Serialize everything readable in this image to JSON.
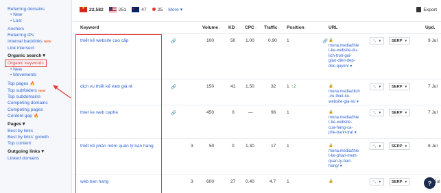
{
  "sidebar": {
    "referring_domains": "Referring domains",
    "rd_new": "• New",
    "rd_lost": "• Lost",
    "anchors": "Anchors",
    "referring_ips": "Referring IPs",
    "internal_backlinks": "Internal backlinks",
    "internal_backlinks_tag": "NEW",
    "link_intersect": "Link intersect",
    "organic_search": "Organic search ▾",
    "organic_keywords": "Organic keywords",
    "ok_new": "• New",
    "ok_movements": "• Movements",
    "top_pages": "Top pages",
    "top_subfolders": "Top subfolders",
    "top_subfolders_tag": "NEW",
    "top_subdomains": "Top subdomains",
    "competing_domains": "Competing domains",
    "competing_pages": "Competing pages",
    "content_gap": "Content gap",
    "pages": "Pages ▾",
    "best_by_links": "Best by links",
    "best_by_links_growth": "Best by links' growth",
    "top_content": "Top content",
    "outgoing_links": "Outgoing links ▾",
    "linked_domains": "Linked domains"
  },
  "filters": {
    "vn_count": "22,582",
    "us_count": "251",
    "au_count": "47",
    "other_count": "25",
    "more": "More ▾"
  },
  "export_label": "Export",
  "columns": {
    "keyword": "Keyword",
    "volume": "Volume",
    "kd": "KD",
    "cpc": "CPC",
    "traffic": "Traffic",
    "position": "Position",
    "url": "URL",
    "upd": "Upd."
  },
  "rows": [
    {
      "keyword": "thiết kế website cao cấp",
      "links": "",
      "volume": "100",
      "kd": "50",
      "cpc": "1.00",
      "traffic": "0.90",
      "position": "1",
      "change": "",
      "url_lines": [
        "mona.media/thie",
        "t-ke-website-du-",
        "lich-tron-goi-",
        "giao-dien-dep-",
        "doc-quyen/ ▾"
      ],
      "upd": "9 Jul"
    },
    {
      "keyword": "dịch vụ thiết kế web giá rẻ",
      "links": "",
      "volume": "150",
      "kd": "41",
      "cpc": "1.50",
      "traffic": "32",
      "position": "1",
      "change": "↑2",
      "url_lines": [
        "mona.media/dich",
        "-vu-thiet-ke-",
        "website-gia-re/ ▾"
      ],
      "upd": "7 Jul"
    },
    {
      "keyword": "thiet ke web caphe",
      "links": "",
      "volume": "450",
      "kd": "0",
      "cpc": "—",
      "traffic": "96",
      "position": "1",
      "change": "",
      "url_lines": [
        "mona.media/thie",
        "t-ke-website-",
        "cua-hang-ca-",
        "phe-banh-tra/ ▾"
      ],
      "upd": "7 Jul"
    },
    {
      "keyword": "thiết kế phần mềm quản lý bán hàng",
      "links": "3",
      "volume": "50",
      "kd": "0",
      "cpc": "1.30",
      "traffic": "17",
      "position": "1",
      "change": "",
      "url_lines": [
        "mona.media/thie",
        "t-ke-phan-mem-",
        "quan-ly-ban-",
        "hang/ ▾"
      ],
      "upd": "8 Jul"
    },
    {
      "keyword": "web ban hang",
      "links": "3",
      "volume": "600",
      "kd": "27",
      "cpc": "0.40",
      "traffic": "4.7",
      "position": "1",
      "change": "",
      "url_lines": [
        ""
      ],
      "upd": "29 Jul"
    }
  ],
  "buttons": {
    "serp": "SERP"
  },
  "help": "?",
  "colors": {
    "accent": "#2f63d0",
    "annotation": "#e53935",
    "sidebar_bg": "#f5f7fb"
  }
}
